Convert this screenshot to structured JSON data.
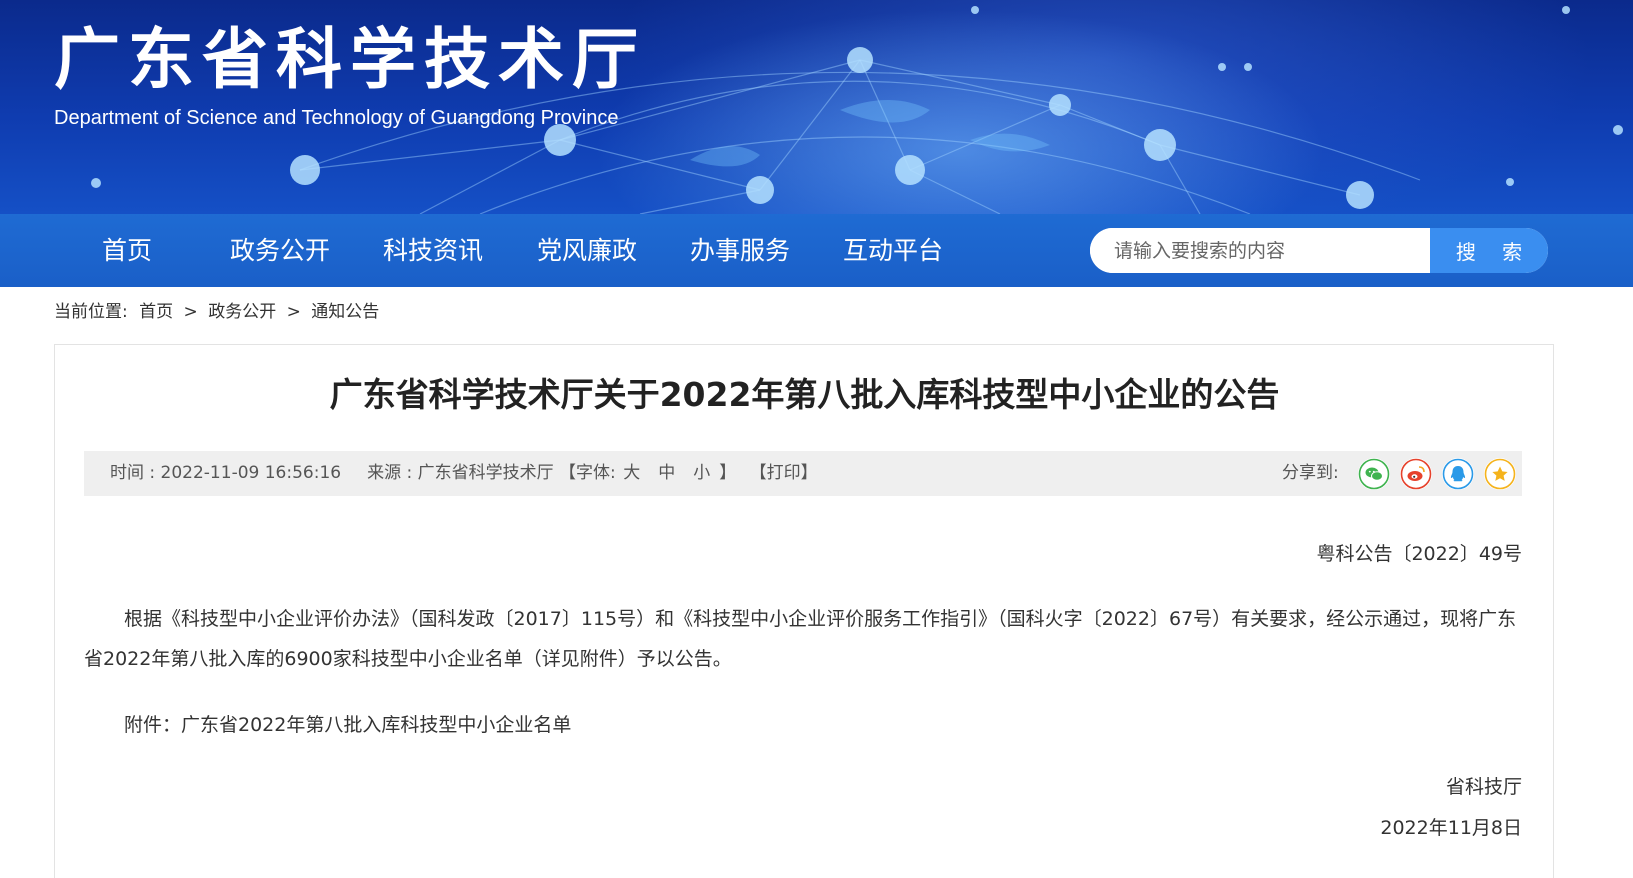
{
  "header": {
    "title": "广东省科学技术厅",
    "subtitle": "Department of Science and Technology of Guangdong Province"
  },
  "nav": {
    "items": [
      "首页",
      "政务公开",
      "科技资讯",
      "党风廉政",
      "办事服务",
      "互动平台"
    ]
  },
  "search": {
    "placeholder": "请输入要搜索的内容",
    "button_label": "搜 索"
  },
  "breadcrumb": {
    "label": "当前位置:",
    "items": [
      "首页",
      "政务公开",
      "通知公告"
    ],
    "separator": ">"
  },
  "article": {
    "title": "广东省科学技术厅关于2022年第八批入库科技型中小企业的公告",
    "meta": {
      "time_label": "时间 : 2022-11-09 16:56:16",
      "source_label": "来源 : 广东省科学技术厅",
      "font_open": "【字体:",
      "font_large": "大",
      "font_medium": "中",
      "font_small": "小",
      "font_close": "】",
      "print": "【打印】",
      "share_label": "分享到:"
    },
    "share_icons": [
      {
        "name": "wechat-icon",
        "color": "#3fb34f"
      },
      {
        "name": "weibo-icon",
        "color": "#e6422c"
      },
      {
        "name": "qq-icon",
        "color": "#2b9ae8"
      },
      {
        "name": "qzone-icon",
        "color": "#f5b31c"
      }
    ],
    "doc_number": "粤科公告〔2022〕49号",
    "paragraph_1": "根据《科技型中小企业评价办法》（国科发政〔2017〕115号）和《科技型中小企业评价服务工作指引》（国科火字〔2022〕67号）有关要求，经公示通过，现将广东省2022年第八批入库的6900家科技型中小企业名单（详见附件）予以公告。",
    "attachment": "附件：广东省2022年第八批入库科技型中小企业名单",
    "signature_org": "省科技厅",
    "signature_date": "2022年11月8日"
  },
  "colors": {
    "banner_dark": "#0b2a8c",
    "nav_blue": "#1f6bd3",
    "search_button": "#3a8ef0",
    "meta_bg": "#efefef"
  }
}
